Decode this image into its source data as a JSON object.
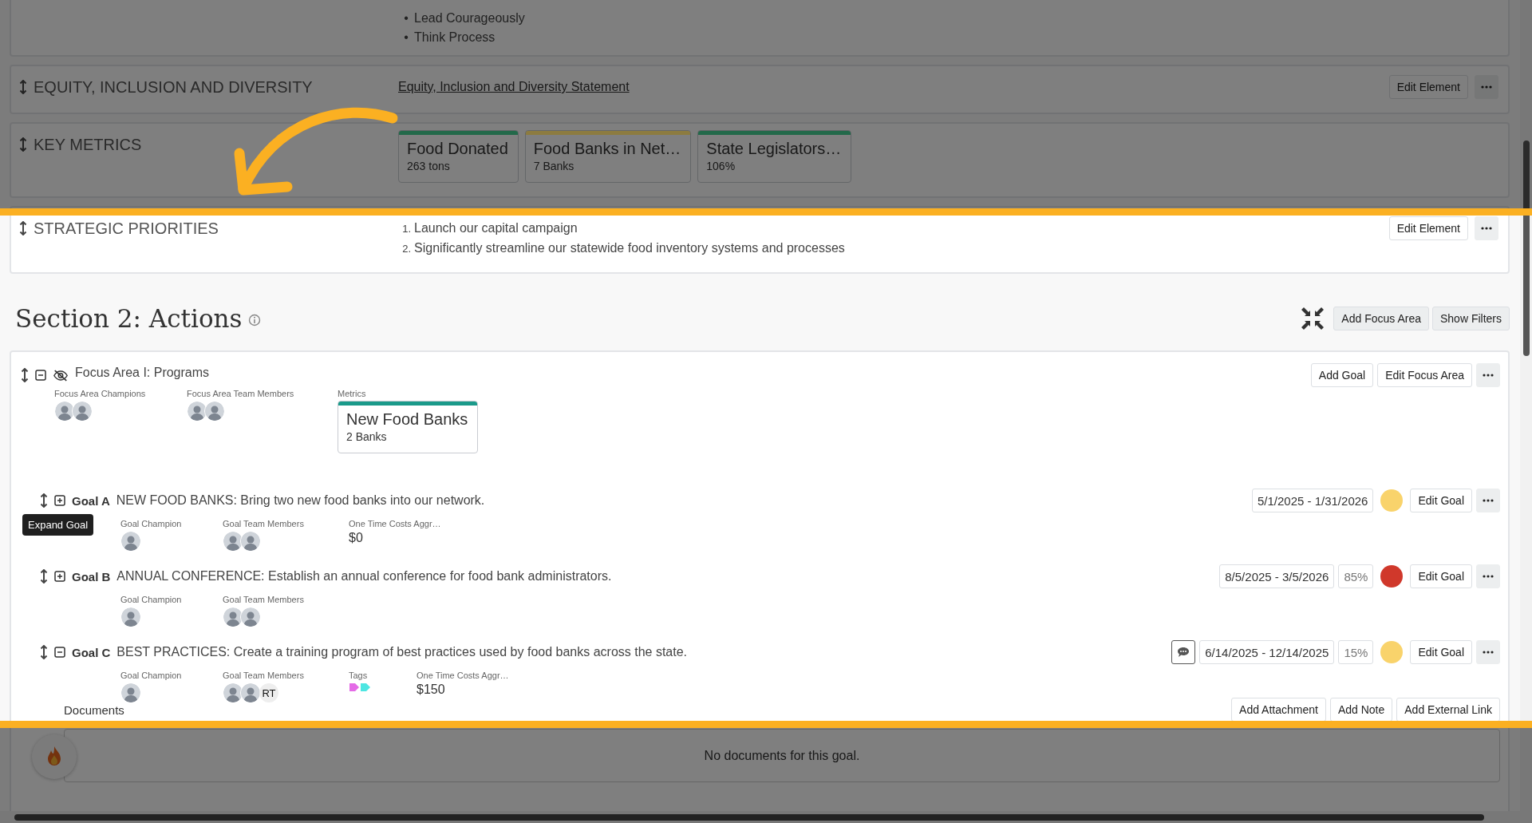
{
  "elements": [
    {
      "kind": "bullets",
      "items": [
        {
          "marker": "•",
          "text": "Lead Courageously"
        },
        {
          "marker": "•",
          "text": "Think Process"
        }
      ]
    },
    {
      "kind": "link",
      "title": "EQUITY, INCLUSION AND DIVERSITY",
      "link": "Equity, Inclusion and Diversity Statement",
      "edit_button": "Edit Element"
    },
    {
      "kind": "metrics",
      "title": "KEY METRICS",
      "metrics": [
        {
          "name": "Food Donated",
          "value": "263 tons",
          "color": "#23694a"
        },
        {
          "name": "Food Banks in Net…",
          "value": "7 Banks",
          "color": "#8c7b40"
        },
        {
          "name": "State Legislators…",
          "value": "106%",
          "color": "#23694a"
        }
      ]
    },
    {
      "kind": "numbered",
      "title": "STRATEGIC PRIORITIES",
      "items": [
        {
          "marker": "1.",
          "text": "Launch our capital campaign"
        },
        {
          "marker": "2.",
          "text": "Significantly streamline our statewide food inventory systems and processes"
        }
      ],
      "edit_button": "Edit Element"
    }
  ],
  "section": {
    "title": "Section 2: Actions",
    "buttons": [
      "Add Focus Area",
      "Show Filters"
    ]
  },
  "focus_area": {
    "title": "Focus Area I: Programs",
    "expanded": true,
    "buttons": [
      "Add Goal",
      "Edit Focus Area"
    ],
    "fields": [
      {
        "kind": "people",
        "label": "Focus Area Champions",
        "people": [
          {
            "kind": "photo"
          },
          {
            "kind": "photo"
          }
        ]
      },
      {
        "kind": "people",
        "label": "Focus Area Team Members",
        "people": [
          {
            "kind": "photo"
          },
          {
            "kind": "photo"
          }
        ]
      },
      {
        "kind": "metrics",
        "label": "Metrics",
        "metrics": [
          {
            "name": "New Food Banks",
            "value": "2 Banks",
            "color": "#1a9a8a"
          }
        ]
      }
    ],
    "goals": [
      {
        "label": "Goal A",
        "text": "NEW FOOD BANKS: Bring two new food banks into our network.",
        "expanded": false,
        "tooltip": "Expand Goal",
        "comment": false,
        "dates": "5/1/2025 - 1/31/2026",
        "color": "#f9d36b",
        "edit_button": "Edit Goal",
        "fields": [
          {
            "kind": "people",
            "label": "Goal Champion",
            "people": [
              {
                "kind": "photo"
              }
            ]
          },
          {
            "kind": "people",
            "label": "Goal Team Members",
            "people": [
              {
                "kind": "photo"
              },
              {
                "kind": "photo"
              }
            ]
          },
          {
            "kind": "value",
            "label": "One Time Costs Aggr…",
            "value": "$0"
          }
        ]
      },
      {
        "label": "Goal B",
        "text": "ANNUAL CONFERENCE: Establish an annual conference for food bank administrators.",
        "expanded": false,
        "comment": false,
        "dates": "8/5/2025 - 3/5/2026",
        "percent": "85%",
        "color": "#d0382b",
        "edit_button": "Edit Goal",
        "fields": [
          {
            "kind": "people",
            "label": "Goal Champion",
            "people": [
              {
                "kind": "photo"
              }
            ]
          },
          {
            "kind": "people",
            "label": "Goal Team Members",
            "people": [
              {
                "kind": "photo"
              },
              {
                "kind": "photo"
              }
            ]
          }
        ]
      },
      {
        "label": "Goal C",
        "text": "BEST PRACTICES: Create a training program of best practices used by food banks across the state.",
        "expanded": true,
        "comment": true,
        "dates": "6/14/2025 - 12/14/2025",
        "percent": "15%",
        "color": "#f9d36b",
        "edit_button": "Edit Goal",
        "fields": [
          {
            "kind": "people",
            "label": "Goal Champion",
            "people": [
              {
                "kind": "photo"
              }
            ]
          },
          {
            "kind": "people",
            "label": "Goal Team Members",
            "people": [
              {
                "kind": "photo"
              },
              {
                "kind": "photo"
              },
              {
                "kind": "initials",
                "initials": "RT"
              }
            ]
          },
          {
            "kind": "tags",
            "label": "Tags",
            "tags": [
              {
                "color": "#e46be6"
              },
              {
                "color": "#4ee6e2"
              }
            ]
          },
          {
            "kind": "value",
            "label": "One Time Costs Aggr…",
            "value": "$150"
          }
        ],
        "documents": {
          "title": "Documents",
          "buttons": [
            "Add Attachment",
            "Add Note",
            "Add External Link"
          ],
          "empty_text": "No documents for this goal."
        }
      }
    ]
  }
}
